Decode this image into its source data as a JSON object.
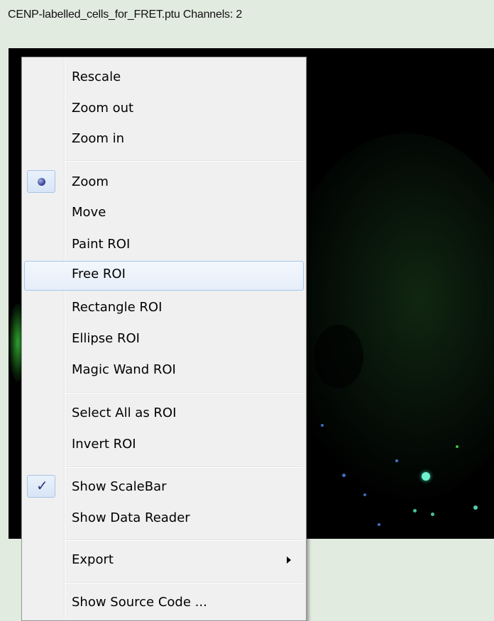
{
  "window": {
    "title": "CENP-labelled_cells_for_FRET.ptu Channels: 2"
  },
  "context_menu": {
    "group_view": [
      "Rescale",
      "Zoom out",
      "Zoom in"
    ],
    "group_tools": {
      "zoom": "Zoom",
      "move": "Move",
      "paint_roi": "Paint ROI",
      "free_roi": "Free ROI",
      "rectangle_roi": "Rectangle ROI",
      "ellipse_roi": "Ellipse ROI",
      "magic_wand_roi": "Magic Wand ROI"
    },
    "group_roi": [
      "Select All as ROI",
      "Invert ROI"
    ],
    "group_show": {
      "scalebar": "Show ScaleBar",
      "data_reader": "Show Data Reader"
    },
    "export": "Export",
    "source_code": "Show Source Code ...",
    "selected_tool": "Zoom",
    "hovered_item": "Free ROI",
    "scalebar_checked": true
  },
  "colors": {
    "chrome_bg": "#e2ebe0",
    "menu_bg": "#f0f0f0",
    "highlight_border": "#a8c8ec",
    "image_bg": "#000000",
    "fluor_green": "#3fbf3f",
    "fluor_cyan": "#5fe6c8"
  },
  "icons": {
    "radio": "radio-bullet-icon",
    "check": "checkmark-icon",
    "submenu": "submenu-arrow-icon"
  }
}
